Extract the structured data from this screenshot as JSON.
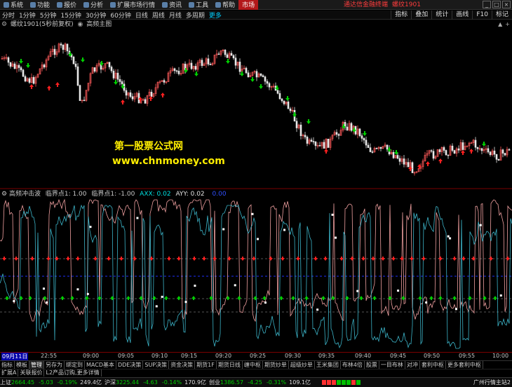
{
  "menu": {
    "items": [
      {
        "label": "系统",
        "icon": "system-icon"
      },
      {
        "label": "功能",
        "icon": "function-icon"
      },
      {
        "label": "报价",
        "icon": "quote-icon"
      },
      {
        "label": "分析",
        "icon": "analysis-icon"
      },
      {
        "label": "扩展市场行情",
        "icon": "extended-market-icon"
      },
      {
        "label": "资讯",
        "icon": "news-icon"
      },
      {
        "label": "工具",
        "icon": "tools-icon"
      },
      {
        "label": "帮助",
        "icon": "help-icon"
      },
      {
        "label": "市场",
        "icon": "",
        "active": true
      }
    ],
    "brand": "通达信金融终端",
    "symbol": "螺纹1901",
    "window_controls": [
      "_",
      "□",
      "×"
    ]
  },
  "periods": {
    "items": [
      "分时",
      "1分钟",
      "5分钟",
      "15分钟",
      "30分钟",
      "60分钟",
      "日线",
      "周线",
      "月线",
      "多周期"
    ],
    "more": "更多",
    "right_buttons": [
      "指标",
      "叠加",
      "统计",
      "画线",
      "F10",
      "标记"
    ]
  },
  "main_chart": {
    "title": "螺纹1901(5秒前复权)",
    "indicator": "高频主图",
    "watermark_cn": "第一股票公式网",
    "watermark_url": "www.chnmoney.com"
  },
  "indicator_panel": {
    "name": "高频冲击波",
    "p1": "临界点1: 1.00",
    "p2": "临界点1: -1.00",
    "axx": "AXX: 0.02",
    "ayy": "AYY: 0.02",
    "extra": "0.00"
  },
  "time_axis": {
    "labels": [
      {
        "t": "09月11日",
        "first": true
      },
      {
        "t": "22:55"
      },
      {
        "t": "09:00"
      },
      {
        "t": "09:05"
      },
      {
        "t": "09:10"
      },
      {
        "t": "09:15"
      },
      {
        "t": "09:20"
      },
      {
        "t": "09:25"
      },
      {
        "t": "09:30"
      },
      {
        "t": "09:35"
      },
      {
        "t": "09:40"
      },
      {
        "t": "09:45"
      },
      {
        "t": "09:50"
      },
      {
        "t": "09:55"
      },
      {
        "t": "10:00"
      }
    ]
  },
  "tabs": {
    "row1": [
      "指标",
      "模板",
      "管理",
      "另存为",
      "绑定到",
      "MACD基本",
      "DDE决策",
      "SUP决策",
      "资金决策",
      "期货1F",
      "期货日线",
      "缠中枢",
      "期货炒单",
      "超级炒单",
      "王米集团",
      "布林4倍",
      "股票",
      "一目布林",
      "对冲",
      "套利中枢",
      "更多套利中枢"
    ],
    "row1_active": 2,
    "row2": [
      "扩展A",
      "关联报价",
      "L2产品订购,更多详情"
    ]
  },
  "status": {
    "items": [
      {
        "name": "上证",
        "price": "2664.45",
        "chg": "-5.03",
        "pct": "-0.19%",
        "vol": "249.4亿"
      },
      {
        "name": "沪深",
        "price": "3225.44",
        "chg": "-4.63",
        "pct": "-0.14%",
        "vol": "170.9亿"
      },
      {
        "name": "创业",
        "price": "1386.57",
        "chg": "-4.25",
        "pct": "-0.31%",
        "vol": "109.1亿"
      }
    ],
    "right_text": "广州行情主站2"
  },
  "colors": {
    "up": "#ff3030",
    "down": "#00d000",
    "accent": "#b3181a",
    "cyan": "#3cb4c8",
    "pink": "#f0a0a0"
  }
}
